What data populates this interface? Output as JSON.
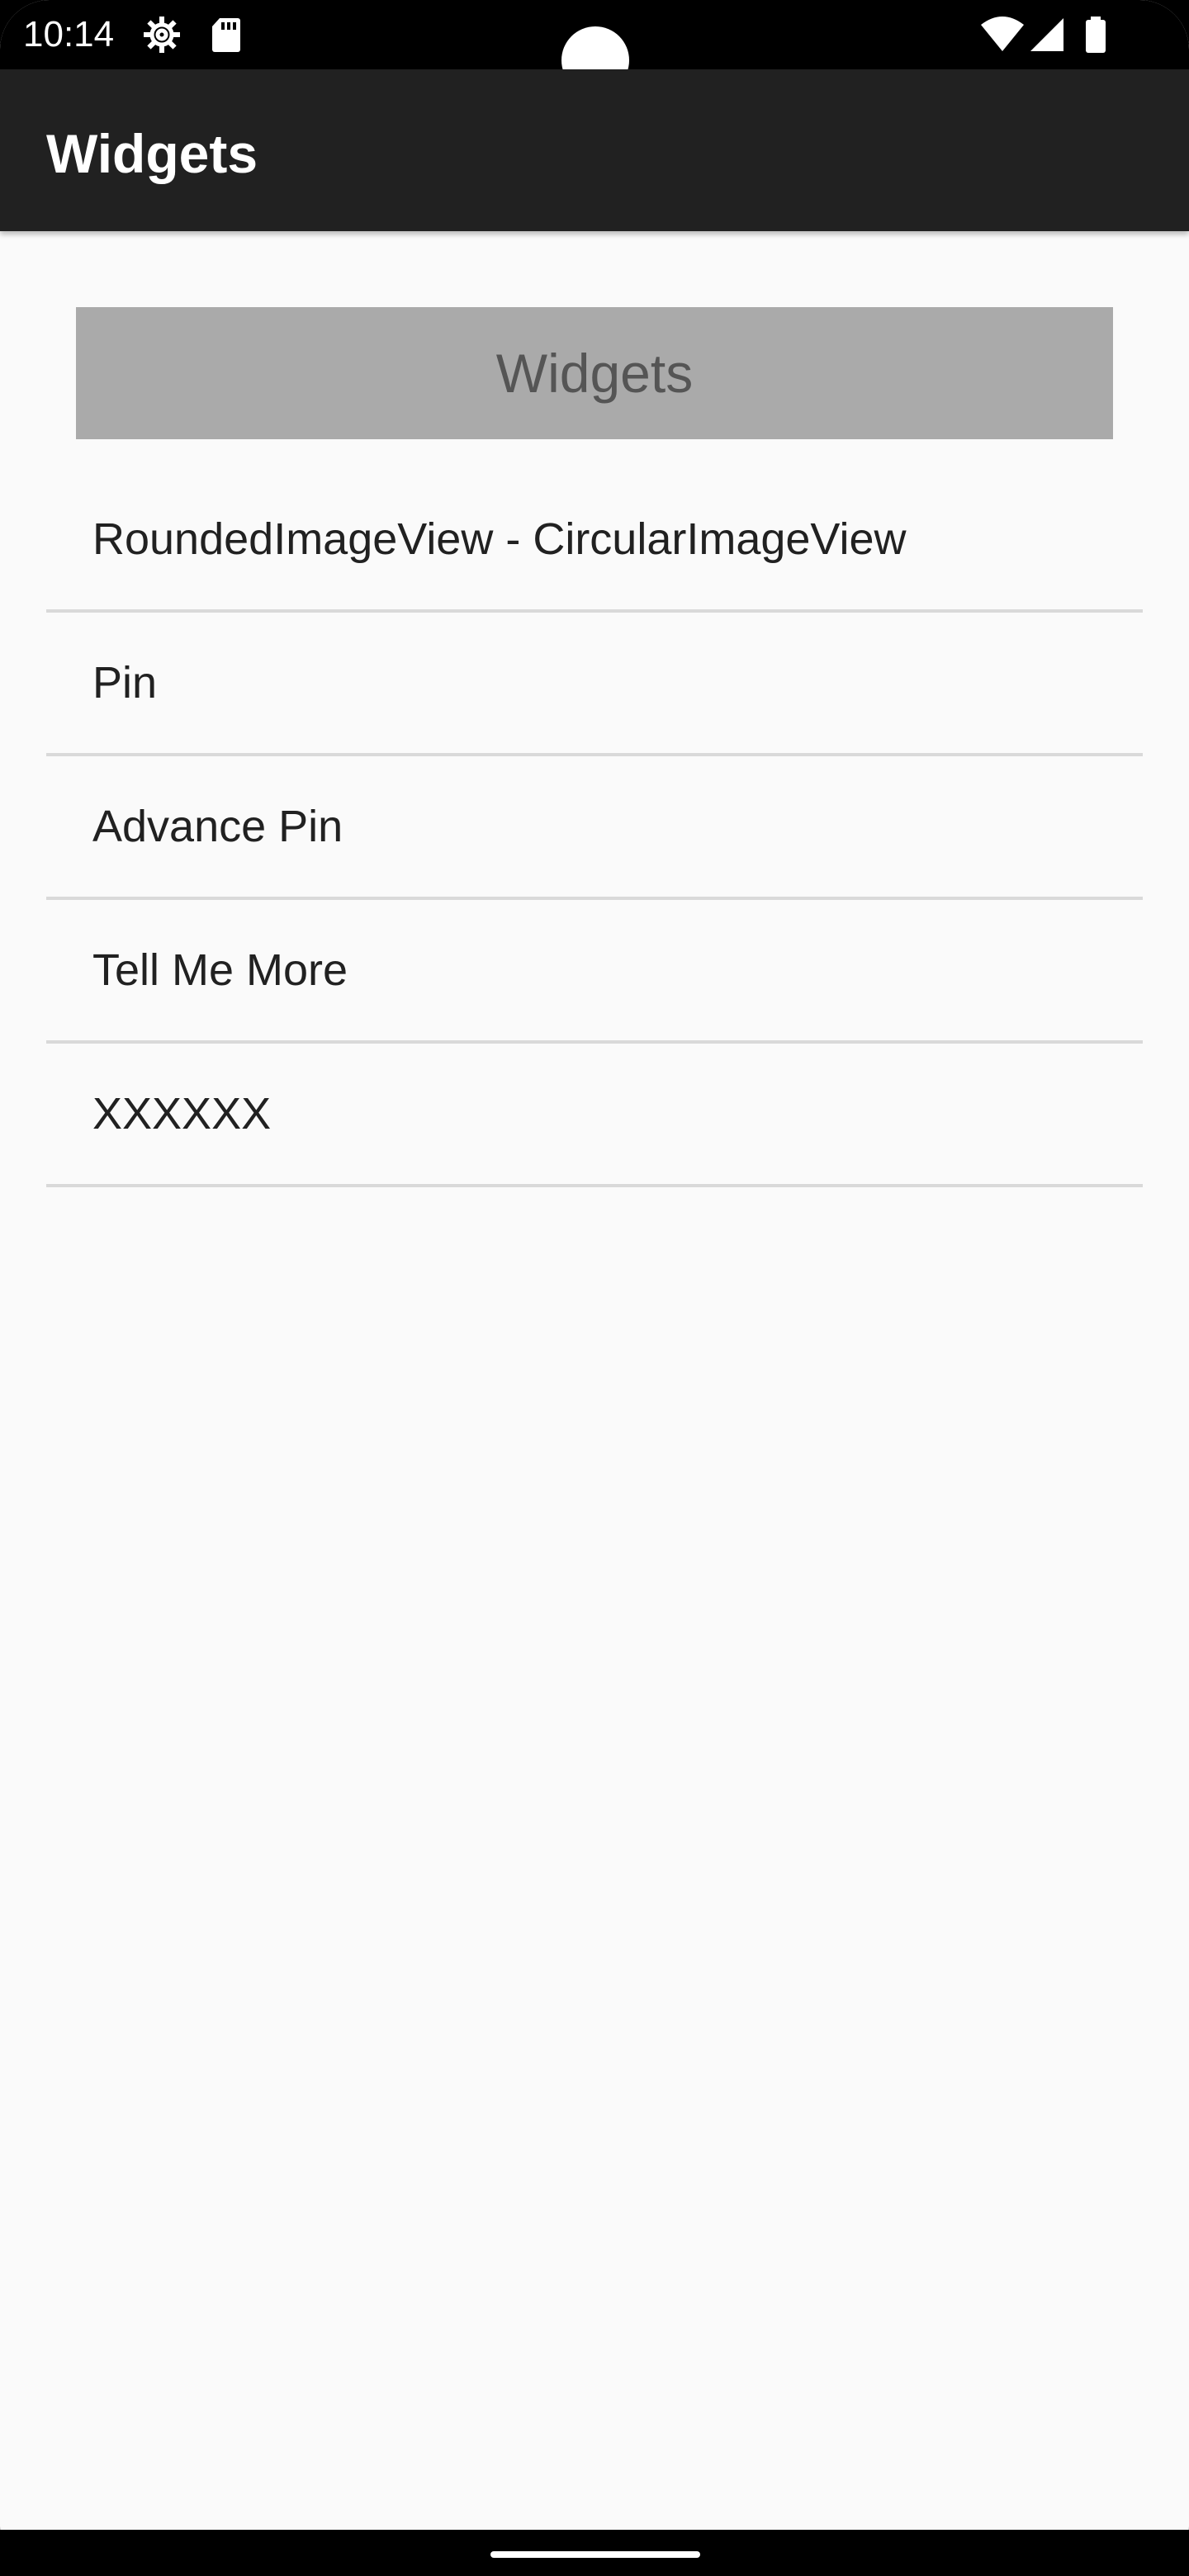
{
  "status_bar": {
    "time": "10:14",
    "icons": [
      "settings-icon",
      "sd-card-icon",
      "wifi-icon",
      "signal-icon",
      "battery-icon"
    ]
  },
  "app_bar": {
    "title": "Widgets",
    "background": "#212121"
  },
  "header": {
    "label": "Widgets",
    "background": "#aaaaaa"
  },
  "list": {
    "items": [
      {
        "label": "RoundedImageView - CircularImageView"
      },
      {
        "label": "Pin"
      },
      {
        "label": "Advance Pin"
      },
      {
        "label": "Tell Me More"
      },
      {
        "label": "XXXXXX"
      }
    ]
  }
}
